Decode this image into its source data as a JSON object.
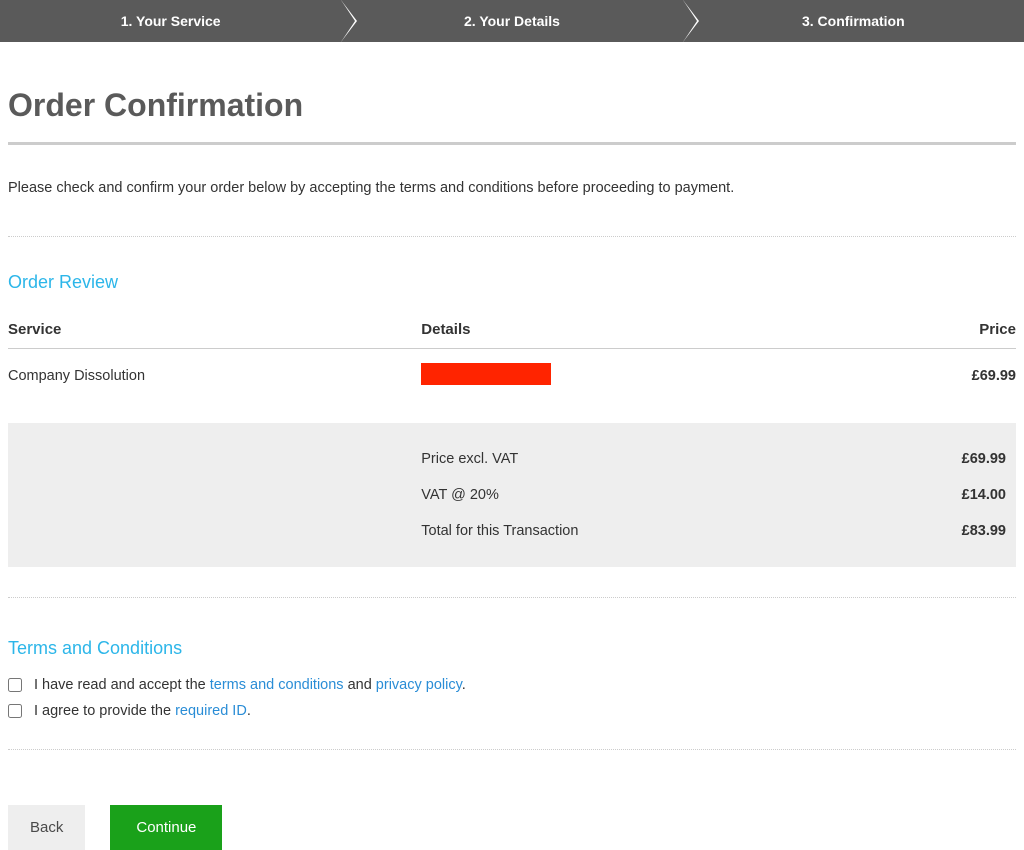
{
  "progress": {
    "step1": "1. Your Service",
    "step2": "2. Your Details",
    "step3": "3. Confirmation"
  },
  "page_title": "Order Confirmation",
  "intro": "Please check and confirm your order below by accepting the terms and conditions before proceeding to payment.",
  "order_review": {
    "heading": "Order Review",
    "headers": {
      "service": "Service",
      "details": "Details",
      "price": "Price"
    },
    "item": {
      "service": "Company Dissolution",
      "price": "£69.99"
    },
    "summary": {
      "excl_vat_label": "Price excl. VAT",
      "excl_vat_value": "£69.99",
      "vat_label": "VAT @ 20%",
      "vat_value": "£14.00",
      "total_label": "Total for this Transaction",
      "total_value": "£83.99"
    }
  },
  "terms": {
    "heading": "Terms and Conditions",
    "line1_prefix": "I have read and accept the ",
    "line1_link1": "terms and conditions",
    "line1_mid": " and ",
    "line1_link2": "privacy policy",
    "line1_suffix": ".",
    "line2_prefix": "I agree to provide the ",
    "line2_link": "required ID",
    "line2_suffix": "."
  },
  "buttons": {
    "back": "Back",
    "continue": "Continue"
  }
}
